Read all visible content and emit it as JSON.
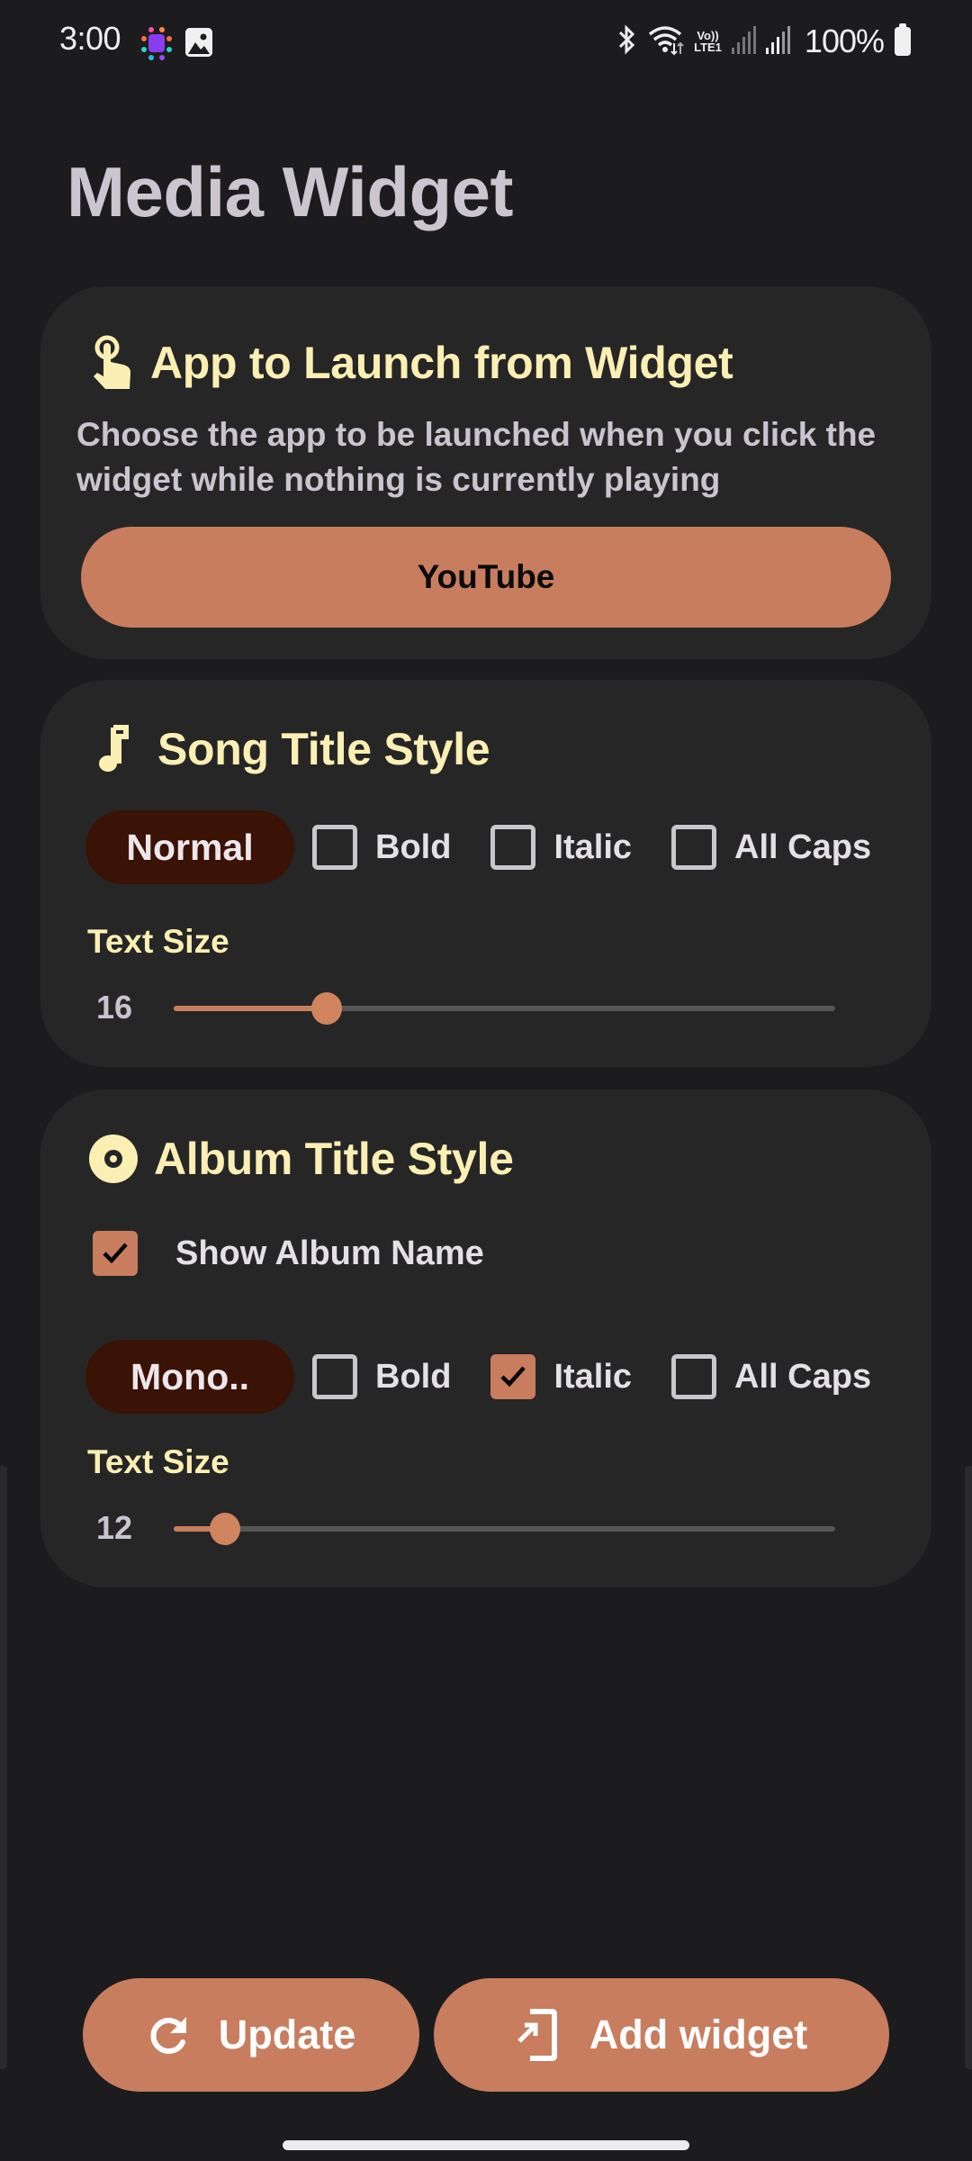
{
  "status_bar": {
    "time": "3:00",
    "notification_icons": [
      "app-notification-icon",
      "gallery-icon"
    ],
    "system_icons": [
      "bluetooth-icon",
      "wifi-icon",
      "volte-lte-icon",
      "signal-icon-sim1",
      "signal-icon-sim2"
    ],
    "volte_line1": "Vo))",
    "volte_line2": "LTE1",
    "battery": "100%"
  },
  "page": {
    "title": "Media Widget"
  },
  "colors": {
    "accent": "#c87d5e",
    "heading": "#fcefb4",
    "chip_bg": "#3a1206",
    "card_bg": "#262626",
    "page_bg": "#1c1c1e"
  },
  "launch_section": {
    "icon": "touch-app-icon",
    "title": "App to Launch from Widget",
    "description": "Choose the app to be launched when you click the widget while nothing is currently playing",
    "selected_app": "YouTube"
  },
  "song_section": {
    "icon": "music-note-icon",
    "title": "Song Title Style",
    "font": "Normal",
    "options": [
      {
        "label": "Bold",
        "checked": false
      },
      {
        "label": "Italic",
        "checked": false
      },
      {
        "label": "All Caps",
        "checked": false
      }
    ],
    "size_label": "Text Size",
    "size_value": "16",
    "size_min": 10,
    "size_max": 36,
    "size": 16
  },
  "album_section": {
    "icon": "album-icon",
    "title": "Album Title Style",
    "show_album_label": "Show Album Name",
    "show_album_checked": true,
    "font": "Mono..",
    "options": [
      {
        "label": "Bold",
        "checked": false
      },
      {
        "label": "Italic",
        "checked": true
      },
      {
        "label": "All Caps",
        "checked": false
      }
    ],
    "size_label": "Text Size",
    "size_value": "12",
    "size_min": 10,
    "size_max": 36,
    "size": 12
  },
  "actions": {
    "update_label": "Update",
    "add_widget_label": "Add widget"
  }
}
